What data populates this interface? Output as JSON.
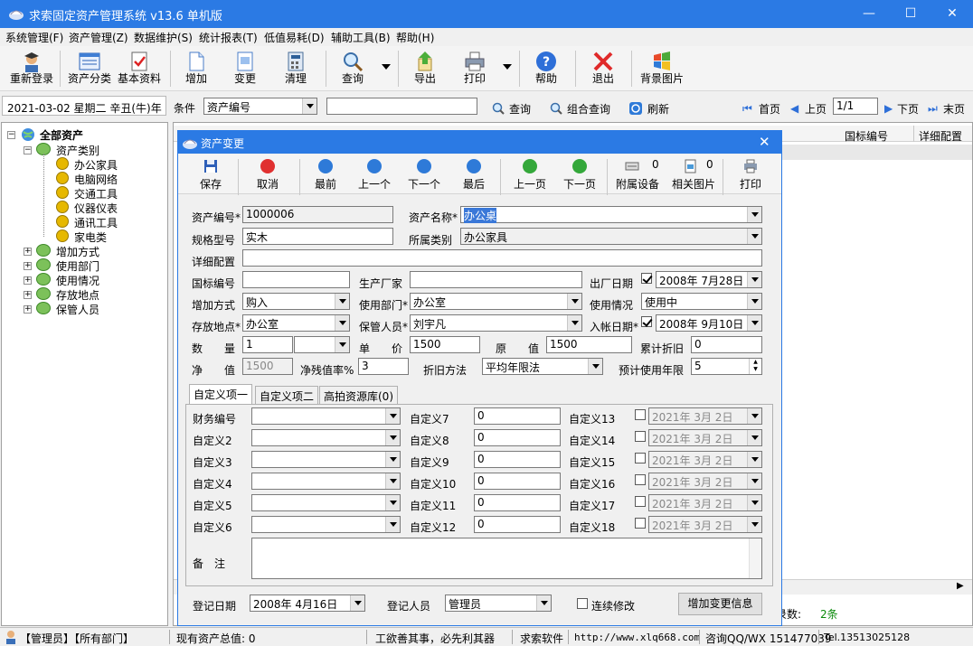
{
  "window": {
    "title": "求索固定资产管理系统 v13.6 单机版",
    "min": "—",
    "max": "☐",
    "close": "✕"
  },
  "menu": [
    "系统管理(F)",
    "资产管理(Z)",
    "数据维护(S)",
    "统计报表(T)",
    "低值易耗(D)",
    "辅助工具(B)",
    "帮助(H)"
  ],
  "toolbar": [
    "重新登录",
    "资产分类",
    "基本资料",
    "增加",
    "变更",
    "清理",
    "查询",
    "导出",
    "打印",
    "帮助",
    "退出",
    "背景图片"
  ],
  "filter": {
    "date": "2021-03-02 星期二 辛丑(牛)年",
    "condition_label": "条件",
    "condition_value": "资产编号",
    "query": "查询",
    "combined_query": "组合查询",
    "refresh": "刷新",
    "first": "首页",
    "prev": "上页",
    "page": "1/1",
    "next": "下页",
    "last": "末页"
  },
  "tree": {
    "root": "全部资产",
    "category": "资产类别",
    "category_children": [
      "办公家具",
      "电脑网络",
      "交通工具",
      "仪器仪表",
      "通讯工具",
      "家电类"
    ],
    "others": [
      "增加方式",
      "使用部门",
      "使用情况",
      "存放地点",
      "保管人员"
    ]
  },
  "grid": {
    "col_a": "国标编号",
    "col_b": "详细配置",
    "record_label": "记录数:",
    "record_count": "2条"
  },
  "dialog": {
    "title": "资产变更",
    "toolbar": {
      "save": "保存",
      "cancel": "取消",
      "first": "最前",
      "prev": "上一个",
      "next": "下一个",
      "last": "最后",
      "prev_page": "上一页",
      "next_page": "下一页",
      "accessory": "附属设备",
      "accessory_count": "0",
      "pictures": "相关图片",
      "pictures_count": "0",
      "print": "打印"
    },
    "labels": {
      "asset_code": "资产编号",
      "asset_name": "资产名称",
      "spec": "规格型号",
      "category": "所属类别",
      "detail": "详细配置",
      "national_code": "国标编号",
      "manufacturer": "生产厂家",
      "factory_date": "出厂日期",
      "add_method": "增加方式",
      "department": "使用部门",
      "usage": "使用情况",
      "location": "存放地点",
      "keeper": "保管人员",
      "entry_date": "入帐日期",
      "qty": "数　　量",
      "unit_price": "单　　价",
      "orig_value": "原　　值",
      "accum_dep": "累计折旧",
      "net_value": "净　　值",
      "residual_rate": "净残值率%",
      "dep_method": "折旧方法",
      "est_years": "预计使用年限"
    },
    "values": {
      "asset_code": "1000006",
      "asset_name": "办公桌",
      "spec": "实木",
      "category": "办公家具",
      "detail": "",
      "national_code": "",
      "manufacturer": "",
      "factory_date": "2008年 7月28日",
      "add_method": "购入",
      "department": "办公室",
      "usage": "使用中",
      "location": "办公室",
      "keeper": "刘宇凡",
      "entry_date": "2008年 9月10日",
      "qty": "1",
      "qty_unit": "",
      "unit_price": "1500",
      "orig_value": "1500",
      "accum_dep": "0",
      "net_value": "1500",
      "residual_rate": "3",
      "dep_method": "平均年限法",
      "est_years": "5"
    },
    "tabs": [
      "自定义项一",
      "自定义项二",
      "高拍资源库(0)"
    ],
    "custom": {
      "col1_labels": [
        "财务编号",
        "自定义2",
        "自定义3",
        "自定义4",
        "自定义5",
        "自定义6"
      ],
      "col2_labels": [
        "自定义7",
        "自定义8",
        "自定义9",
        "自定义10",
        "自定义11",
        "自定义12"
      ],
      "col2_values": [
        "0",
        "0",
        "0",
        "0",
        "0",
        "0"
      ],
      "col3_labels": [
        "自定义13",
        "自定义14",
        "自定义15",
        "自定义16",
        "自定义17",
        "自定义18"
      ],
      "col3_dates": [
        "2021年 3月 2日",
        "2021年 3月 2日",
        "2021年 3月 2日",
        "2021年 3月 2日",
        "2021年 3月 2日",
        "2021年 3月 2日"
      ]
    },
    "remark_label": "备　注",
    "footer": {
      "reg_date_label": "登记日期",
      "reg_date": "2008年 4月16日",
      "reg_person_label": "登记人员",
      "reg_person": "管理员",
      "continuous": "连续修改",
      "submit": "增加变更信息"
    }
  },
  "status": {
    "user": "【管理员】【所有部门】",
    "total": "现有资产总值: 0",
    "motto": "工欲善其事，必先利其器",
    "company": "求索软件",
    "url": "http://www.xlq668.com",
    "contact": "咨询QQ/WX 151477039",
    "tel": "Tel.13513025128"
  }
}
